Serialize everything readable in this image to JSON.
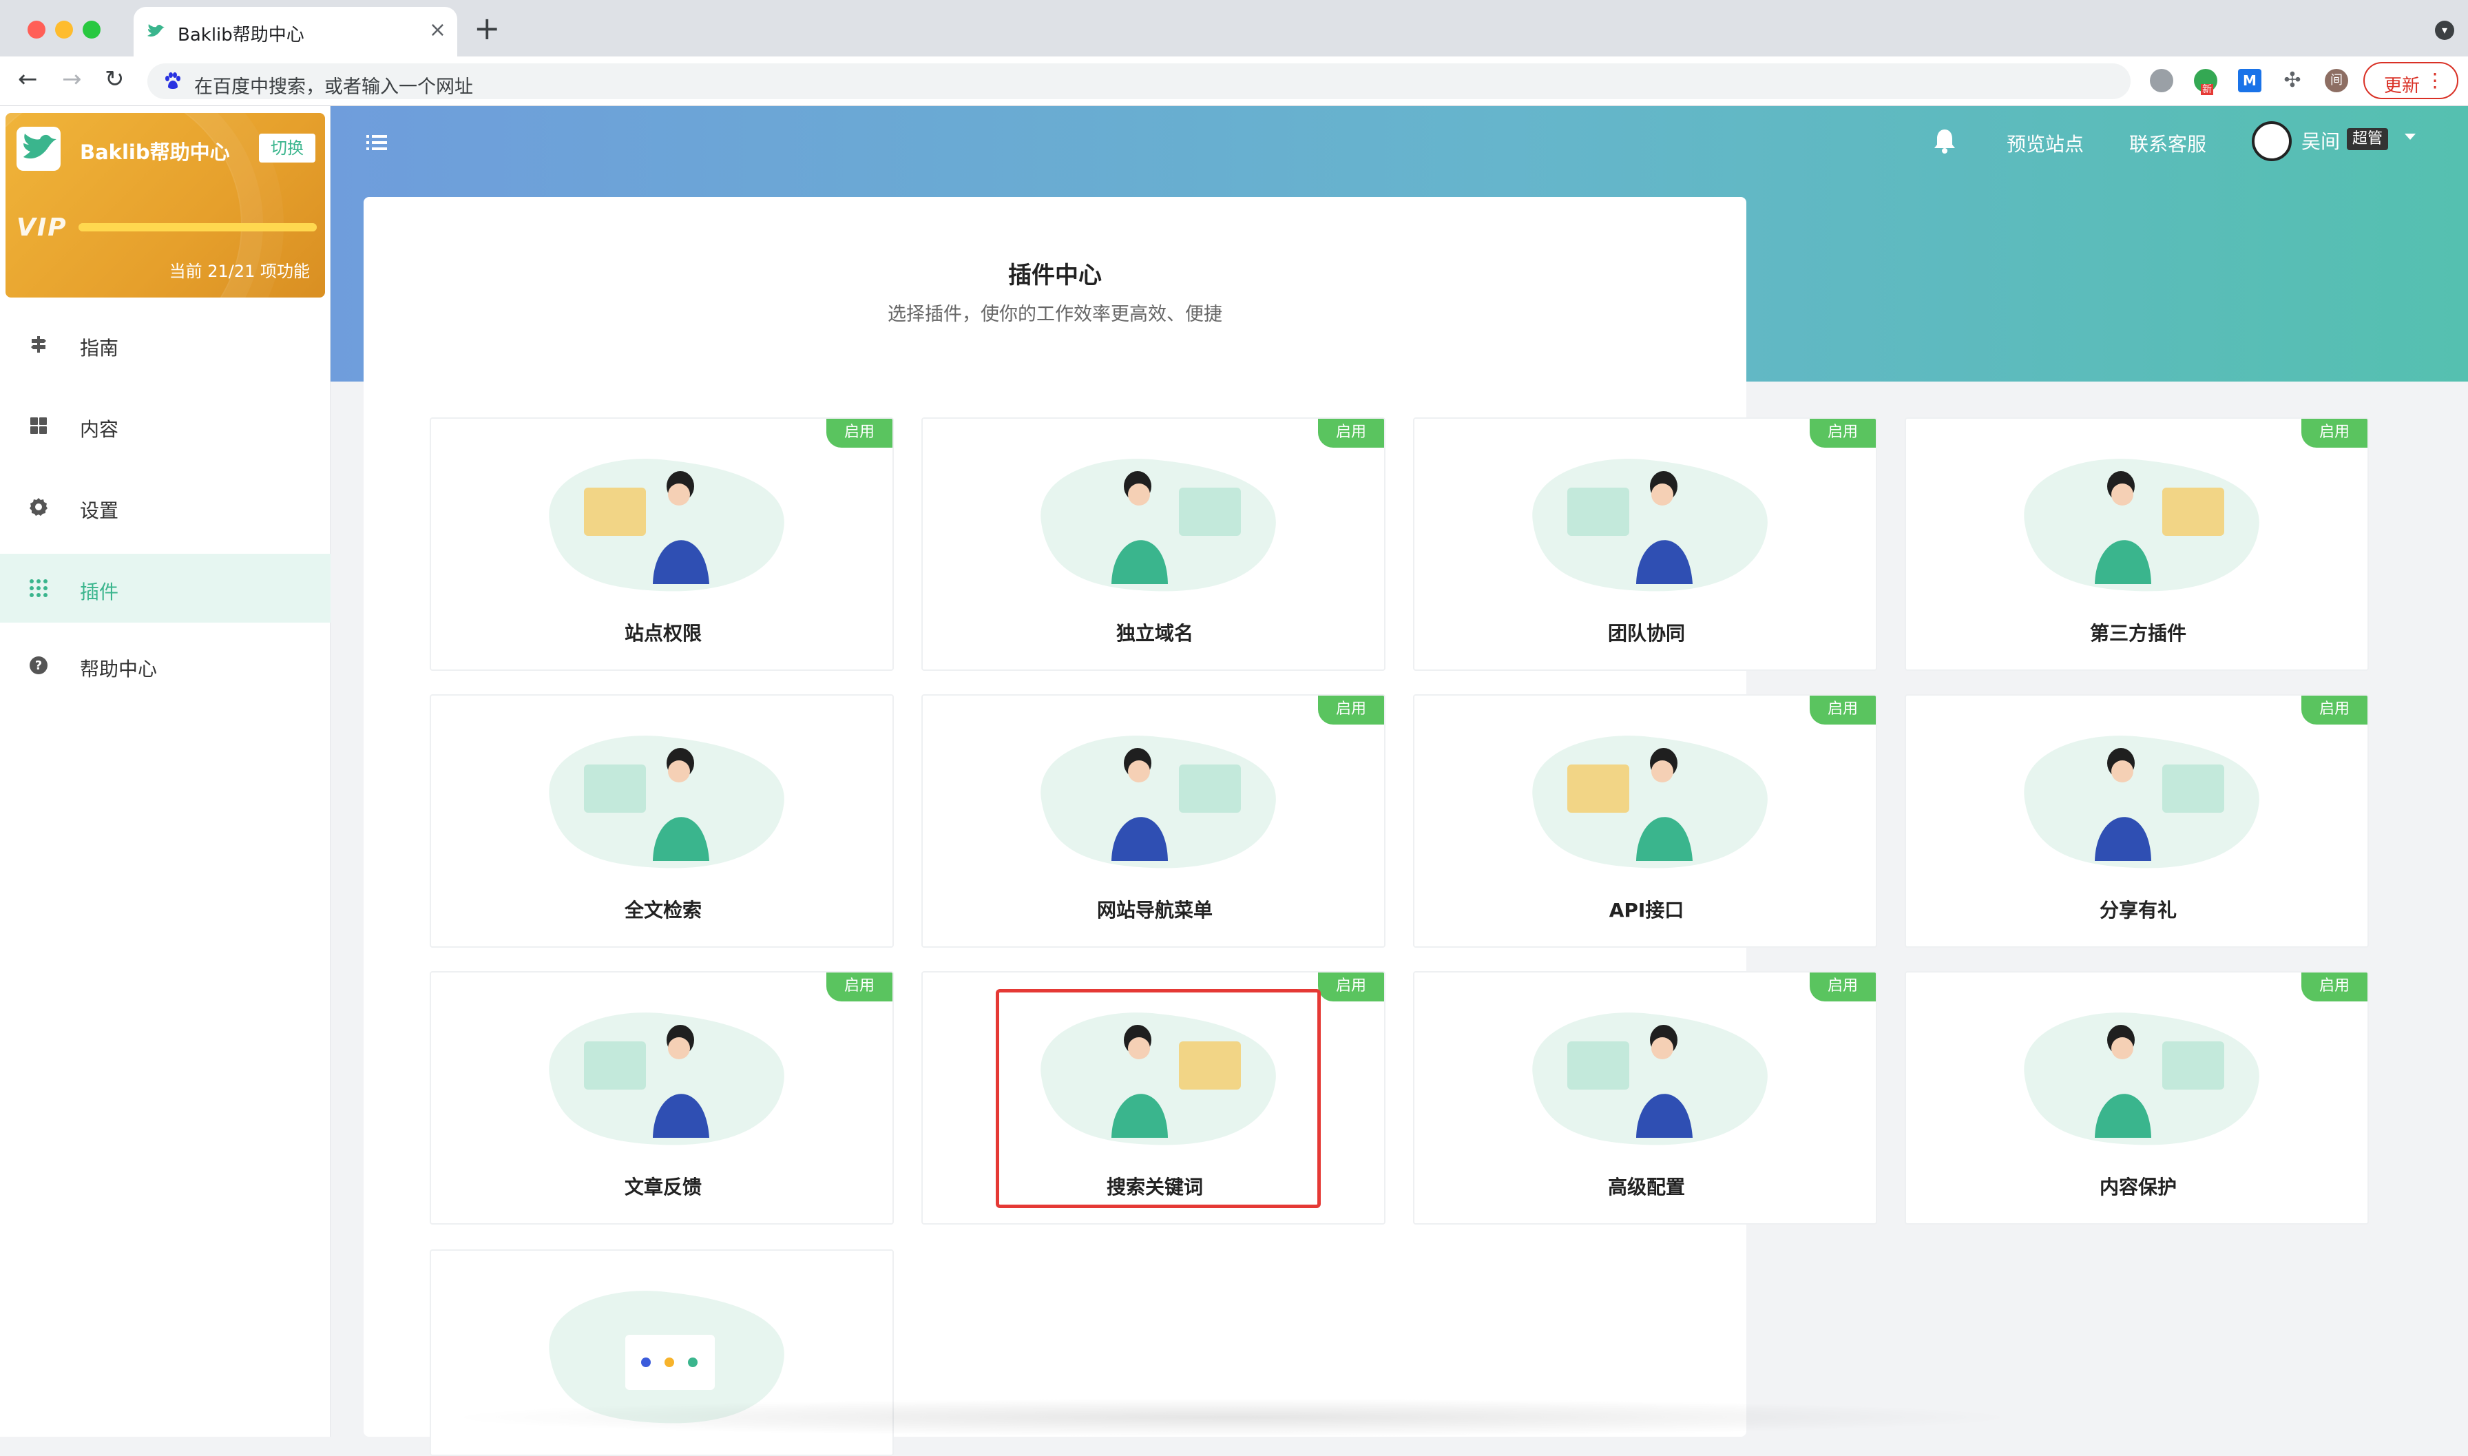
{
  "browser": {
    "tab_title": "Baklib帮助中心",
    "tab_close": "×",
    "new_tab": "+",
    "address_placeholder": "在百度中搜索，或者输入一个网址",
    "update_label": "更新",
    "update_menu": "⋮",
    "profile_initial": "间",
    "ext_badge": "新",
    "ext_m": "M"
  },
  "sidebar": {
    "site_name": "Baklib帮助中心",
    "switch_label": "切换",
    "vip_mark": "VIP",
    "vip_usage": "当前 21/21 项功能",
    "vip_progress": 1.0,
    "items": [
      {
        "label": "指南",
        "icon": "signpost-icon",
        "active": false
      },
      {
        "label": "内容",
        "icon": "grid-icon",
        "active": false
      },
      {
        "label": "设置",
        "icon": "gear-icon",
        "active": false
      },
      {
        "label": "插件",
        "icon": "apps-icon",
        "active": true
      },
      {
        "label": "帮助中心",
        "icon": "help-icon",
        "active": false
      }
    ]
  },
  "header": {
    "preview_site": "预览站点",
    "contact_support": "联系客服",
    "user_name": "吴间",
    "user_role": "超管"
  },
  "page": {
    "title": "插件中心",
    "subtitle": "选择插件，使你的工作效率更高效、便捷"
  },
  "plugins": [
    {
      "name": "站点权限",
      "badge": "启用",
      "enabled": true
    },
    {
      "name": "独立域名",
      "badge": "启用",
      "enabled": true
    },
    {
      "name": "团队协同",
      "badge": "启用",
      "enabled": true
    },
    {
      "name": "第三方插件",
      "badge": "启用",
      "enabled": true
    },
    {
      "name": "全文检索",
      "badge": "",
      "enabled": false
    },
    {
      "name": "网站导航菜单",
      "badge": "启用",
      "enabled": true
    },
    {
      "name": "API接口",
      "badge": "启用",
      "enabled": true
    },
    {
      "name": "分享有礼",
      "badge": "启用",
      "enabled": true
    },
    {
      "name": "文章反馈",
      "badge": "启用",
      "enabled": true
    },
    {
      "name": "搜索关键词",
      "badge": "启用",
      "enabled": true
    },
    {
      "name": "高级配置",
      "badge": "启用",
      "enabled": true
    },
    {
      "name": "内容保护",
      "badge": "启用",
      "enabled": true
    }
  ],
  "colors": {
    "accent": "#3ab58d",
    "badge_green": "#5ac45f",
    "highlight_red": "#e53935",
    "vip_gold": "#e6a02c"
  }
}
